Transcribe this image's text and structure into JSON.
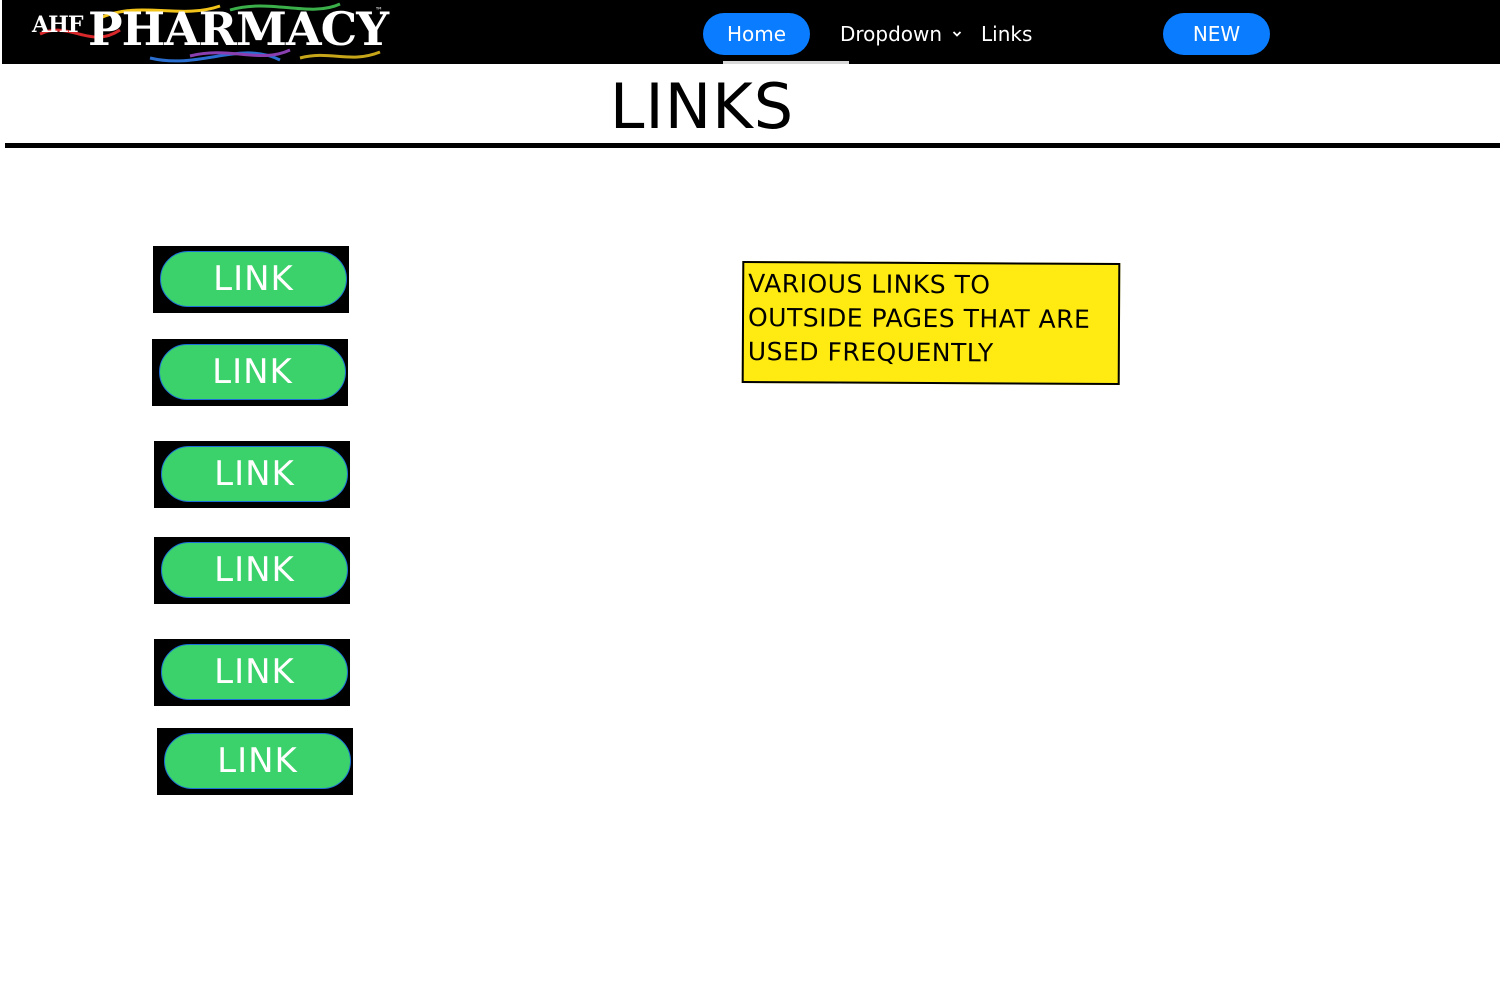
{
  "navbar": {
    "logo": {
      "prefix": "AHF",
      "name": "PHARMACY",
      "tm": "™"
    },
    "items": [
      {
        "label": "Home"
      },
      {
        "label": "Dropdown"
      },
      {
        "label": "Links"
      },
      {
        "label": "NEW"
      }
    ]
  },
  "page": {
    "title": "LINKS"
  },
  "links": [
    {
      "label": "LINK"
    },
    {
      "label": "LINK"
    },
    {
      "label": "LINK"
    },
    {
      "label": "LINK"
    },
    {
      "label": "LINK"
    },
    {
      "label": "LINK"
    }
  ],
  "note": {
    "text": "VARIOUS LINKS TO OUTSIDE PAGES THAT ARE USED FREQUENTLY"
  },
  "colors": {
    "nav_background": "#000000",
    "nav_button": "#0a7cff",
    "link_button": "#3bd16b",
    "note_background": "#ffeb12"
  },
  "icons": {
    "dropdown": "chevron-down-icon"
  }
}
